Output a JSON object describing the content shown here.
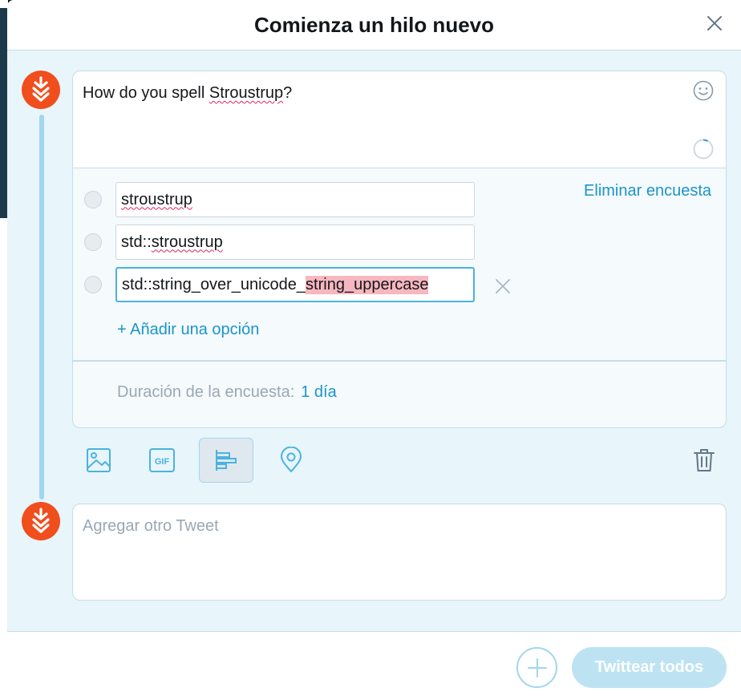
{
  "modal": {
    "title": "Comienza un hilo nuevo",
    "close_icon": "close-icon"
  },
  "tweet1": {
    "text_prefix": "How do you spell ",
    "text_misspelled": "Stroustrup",
    "text_suffix": "?",
    "emoji_icon": "emoji-icon",
    "progress_icon": "character-count-spinner"
  },
  "poll": {
    "remove_label": "Eliminar encuesta",
    "options": [
      {
        "value": "stroustrup"
      },
      {
        "prefix": "std::",
        "value": "stroustrup"
      },
      {
        "prefix": "std::string_over_unicode_",
        "highlighted": "string_uppercase"
      }
    ],
    "add_option_label": "+ Añadir una opción",
    "duration_label": "Duración de la encuesta:",
    "duration_value": "1 día"
  },
  "toolbar": {
    "icons": [
      "image-icon",
      "gif-icon",
      "poll-icon",
      "location-icon"
    ],
    "delete_icon": "trash-icon"
  },
  "tweet2": {
    "placeholder": "Agregar otro Tweet"
  },
  "footer": {
    "add_icon": "plus-icon",
    "tweet_all_label": "Twittear todos"
  },
  "colors": {
    "accent": "#1b95c8",
    "avatar": "#f04e1d",
    "thread_line": "#a2d6ee",
    "button_disabled": "#bde3f3",
    "highlight_error": "#f7b7c0"
  }
}
